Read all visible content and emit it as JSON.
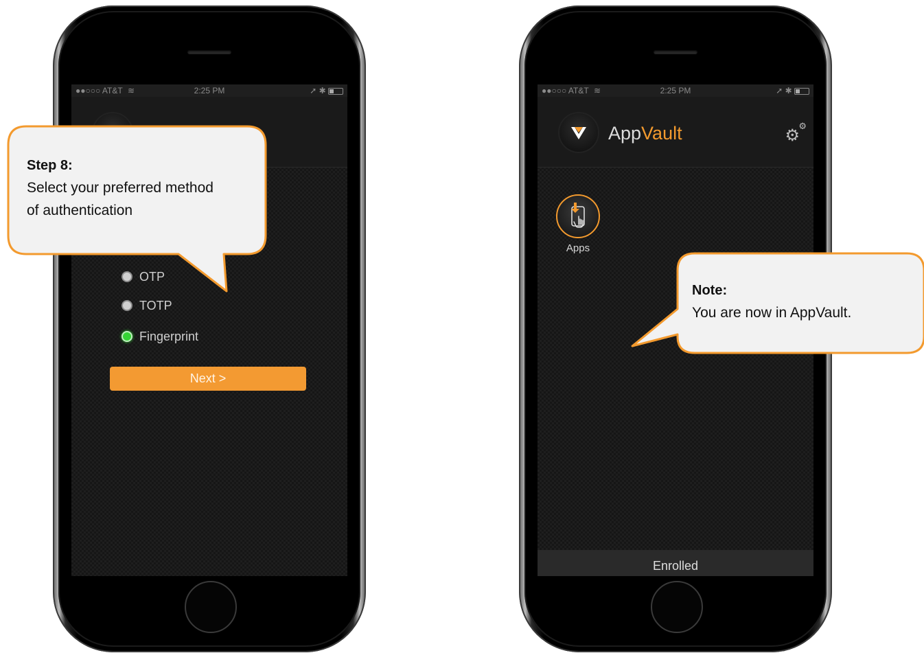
{
  "phone1": {
    "status": {
      "carrier": "●●○○○ AT&T",
      "wifi": "wifi-icon",
      "time": "2:25 PM",
      "right": "➚ ✱"
    },
    "options": [
      {
        "label": "OTP",
        "selected": false
      },
      {
        "label": "TOTP",
        "selected": false
      },
      {
        "label": "Fingerprint",
        "selected": true
      }
    ],
    "next_label": "Next >"
  },
  "phone2": {
    "status": {
      "carrier": "●●○○○ AT&T",
      "wifi": "wifi-icon",
      "time": "2:25 PM",
      "right": "➚ ✱"
    },
    "header": {
      "title_part1": "App",
      "title_part2": "Vault",
      "settings_icon": "gear-icon"
    },
    "apps_label": "Apps",
    "footer_label": "Enrolled"
  },
  "callouts": {
    "step": {
      "title": "Step 8:",
      "body_line1": "Select your preferred method",
      "body_line2": "of authentication"
    },
    "note": {
      "title": "Note:",
      "body": "You are now in AppVault."
    }
  },
  "colors": {
    "accent": "#f39a2e",
    "callout_border": "#f39a2e",
    "callout_fill": "#f2f2f2",
    "selected_radio": "#35d435"
  }
}
